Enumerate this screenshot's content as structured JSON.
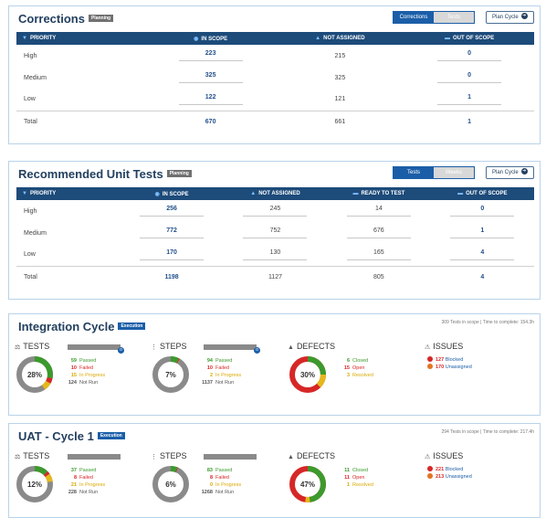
{
  "corrections": {
    "title": "Corrections",
    "badge": "Planning",
    "toggle": [
      "Corrections",
      "Tests"
    ],
    "plan_label": "Plan Cycle",
    "columns": [
      "PRIORITY",
      "IN SCOPE",
      "NOT ASSIGNED",
      "OUT OF SCOPE"
    ],
    "rows": [
      {
        "label": "High",
        "in_scope": "223",
        "not_assigned": "215",
        "out_of_scope": "0"
      },
      {
        "label": "Medium",
        "in_scope": "325",
        "not_assigned": "325",
        "out_of_scope": "0"
      },
      {
        "label": "Low",
        "in_scope": "122",
        "not_assigned": "121",
        "out_of_scope": "1"
      },
      {
        "label": "Total",
        "in_scope": "670",
        "not_assigned": "661",
        "out_of_scope": "1"
      }
    ]
  },
  "unit_tests": {
    "title": "Recommended Unit Tests",
    "badge": "Planning",
    "toggle": [
      "Tests",
      "Weeks"
    ],
    "plan_label": "Plan Cycle",
    "columns": [
      "PRIORITY",
      "IN SCOPE",
      "NOT ASSIGNED",
      "READY TO TEST",
      "OUT OF SCOPE"
    ],
    "rows": [
      {
        "label": "High",
        "in_scope": "256",
        "not_assigned": "245",
        "ready": "14",
        "out_of_scope": "0"
      },
      {
        "label": "Medium",
        "in_scope": "772",
        "not_assigned": "752",
        "ready": "676",
        "out_of_scope": "1"
      },
      {
        "label": "Low",
        "in_scope": "170",
        "not_assigned": "130",
        "ready": "165",
        "out_of_scope": "4"
      },
      {
        "label": "Total",
        "in_scope": "1198",
        "not_assigned": "1127",
        "ready": "805",
        "out_of_scope": "4"
      }
    ]
  },
  "integration": {
    "title": "Integration Cycle",
    "badge": "Execution",
    "scope_text": "309 Tests in scope | Time to complete: 154.3h",
    "tests": {
      "label": "TESTS",
      "percent": 28,
      "pct_label": "28%",
      "passed": "59",
      "failed": "10",
      "in_progress": "15",
      "not_run": "124"
    },
    "steps": {
      "label": "STEPS",
      "percent": 7,
      "pct_label": "7%",
      "passed": "94",
      "failed": "10",
      "in_progress": "2",
      "not_run": "1137"
    },
    "defects": {
      "label": "DEFECTS",
      "percent": 30,
      "pct_label": "30%",
      "closed": "6",
      "open": "15",
      "resolved": "3"
    },
    "issues": {
      "label": "ISSUES",
      "blocked": "127",
      "unassigned": "170"
    }
  },
  "uat": {
    "title": "UAT - Cycle 1",
    "badge": "Execution",
    "scope_text": "294 Tests in scope | Time to complete: 217.4h",
    "tests": {
      "label": "TESTS",
      "percent": 12,
      "pct_label": "12%",
      "passed": "37",
      "failed": "8",
      "in_progress": "21",
      "not_run": "228"
    },
    "steps": {
      "label": "STEPS",
      "percent": 6,
      "pct_label": "6%",
      "passed": "83",
      "failed": "8",
      "in_progress": "0",
      "not_run": "1268"
    },
    "defects": {
      "label": "DEFECTS",
      "percent": 47,
      "pct_label": "47%",
      "closed": "11",
      "open": "11",
      "resolved": "1"
    },
    "issues": {
      "label": "ISSUES",
      "blocked": "221",
      "unassigned": "213"
    }
  },
  "legend_labels": {
    "passed": "Passed",
    "failed": "Failed",
    "in_progress": "In Progress",
    "not_run": "Not Run",
    "closed": "Closed",
    "open": "Open",
    "resolved": "Resolved",
    "blocked": "Blocked",
    "unassigned": "Unassigned"
  },
  "colors": {
    "header": "#1d4b7a",
    "accent": "#1b5ea8",
    "green": "#3c9a2d",
    "red": "#d62727",
    "yellow": "#e5b81a",
    "gray": "#8a8a8a"
  }
}
